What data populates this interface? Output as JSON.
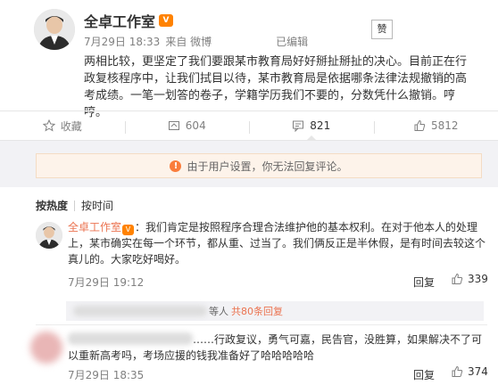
{
  "post": {
    "author": "全卓工作室",
    "vip_badge": "V",
    "time": "7月29日 18:33",
    "source": "来自 微博",
    "edited": "已编辑",
    "like_chip": "赞",
    "text": "两相比较，更坚定了我们要跟某市教育局好好掰扯掰扯的决心。目前正在行政复核程序中，让我们拭目以待，某市教育局是依据哪条法律法规撤销的高考成绩。一笔一划答的卷子，学籍学历我们不要的，分数凭什么撤销。哼哼。"
  },
  "actions": [
    {
      "name": "collect",
      "icon": "star-icon",
      "label": "收藏"
    },
    {
      "name": "repost",
      "icon": "repost-icon",
      "label": "604"
    },
    {
      "name": "comment",
      "icon": "comment-icon",
      "label": "821"
    },
    {
      "name": "like",
      "icon": "thumb-up-icon",
      "label": "5812"
    }
  ],
  "notice": {
    "icon": "warning-icon",
    "text": "由于用户设置，你无法回复评论。"
  },
  "tabs": {
    "hot": "按热度",
    "time": "按时间"
  },
  "comments": [
    {
      "author": "全卓工作室",
      "text": "：我们肯定是按照程序合理合法维护他的基本权利。在对于他本人的处理上，某市确实在每一个环节，都从重、过当了。我们俩反正是半休假，是有时间去较这个真儿的。大家吃好喝好。",
      "time": "7月29日 19:12",
      "reply_label": "回复",
      "likes": "339",
      "replies_tail": "等人",
      "replies_count": "共80条回复"
    },
    {
      "author": "",
      "text": "……行政复议，勇气可嘉，民告官，没胜算，如果解决不了可以重新高考吗，考场应援的钱我准备好了哈哈哈哈哈",
      "time": "7月29日 18:35",
      "reply_label": "回复",
      "likes": "374"
    }
  ],
  "colors": {
    "accent": "#eb7350",
    "vip": "#ff8200",
    "warning": "#fa7d3c",
    "notice_bg": "#fdf3ea"
  }
}
